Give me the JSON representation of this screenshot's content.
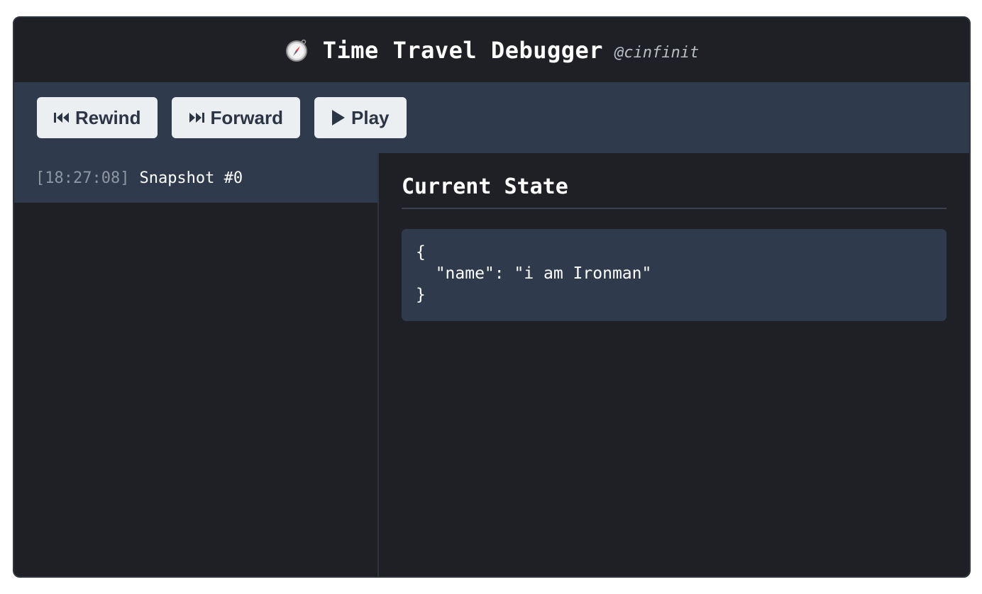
{
  "header": {
    "icon": "compass-icon",
    "title": "Time Travel Debugger",
    "handle": "@cinfinit"
  },
  "toolbar": {
    "rewind_icon": "rewind-icon",
    "rewind_label": "Rewind",
    "forward_icon": "fast-forward-icon",
    "forward_label": "Forward",
    "play_icon": "play-icon",
    "play_label": "Play"
  },
  "timeline": {
    "items": [
      {
        "time": "[18:27:08]",
        "label": "Snapshot #0"
      }
    ]
  },
  "state": {
    "title": "Current State",
    "json": "{\n  \"name\": \"i am Ironman\"\n}"
  },
  "colors": {
    "panel_bg": "#1e2025",
    "toolbar_bg": "#2f3b4c",
    "button_bg": "#eceff1",
    "button_text": "#2b3545"
  }
}
